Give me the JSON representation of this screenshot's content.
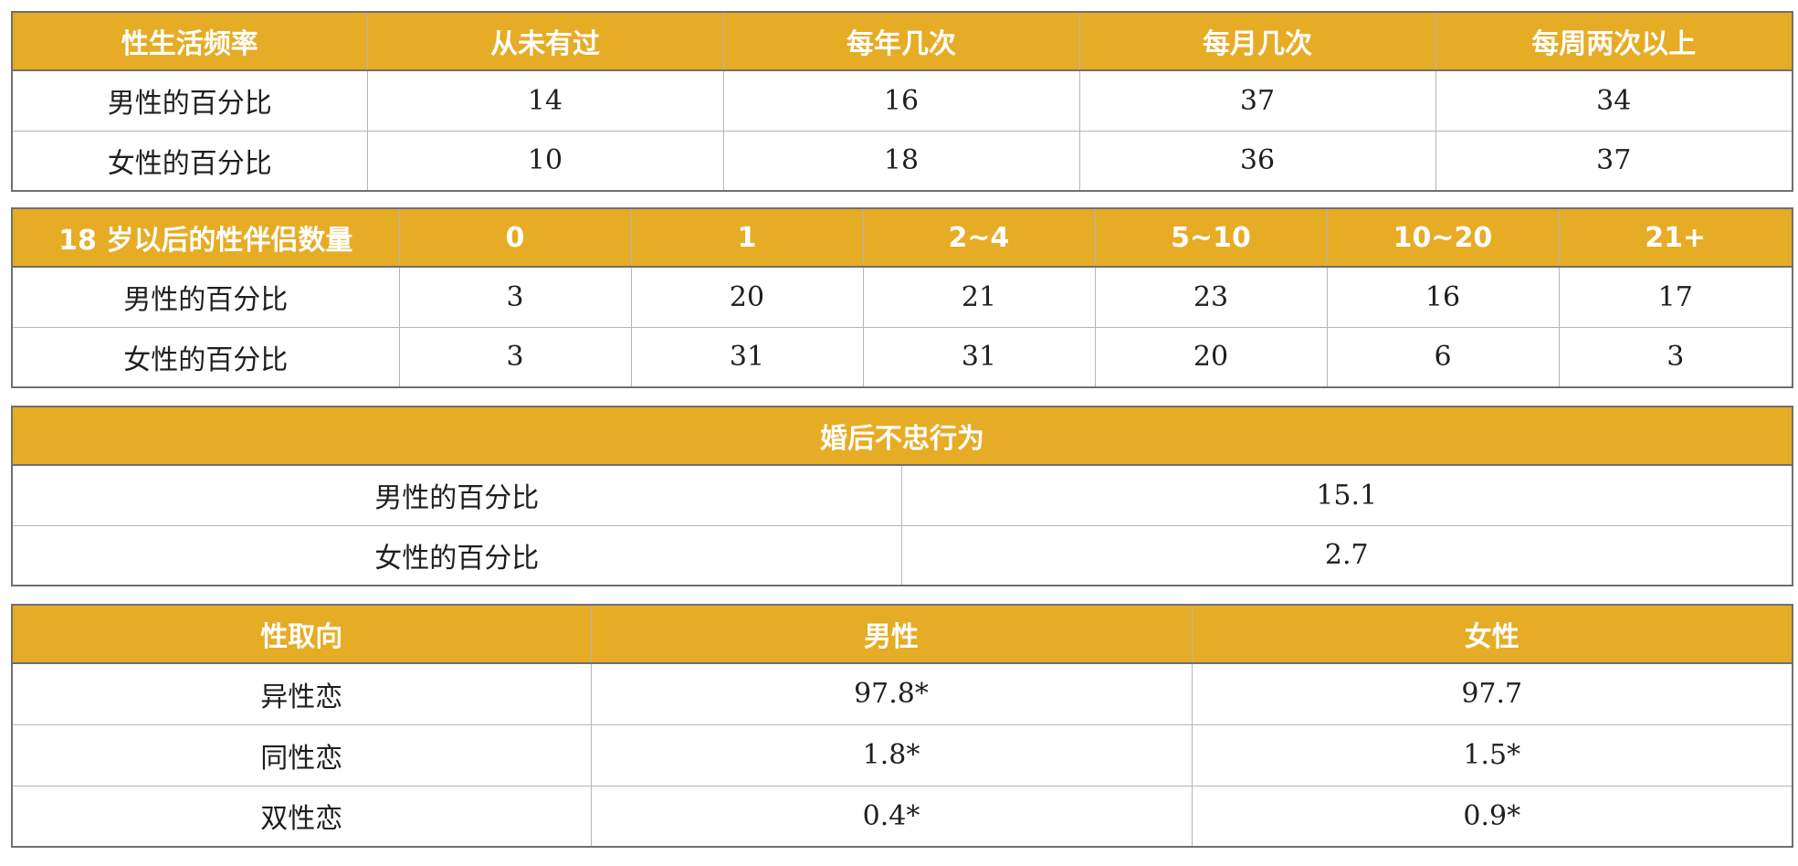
{
  "frequency_table": {
    "headers": [
      "性生活频率",
      "从未有过",
      "每年几次",
      "每月几次",
      "每周两次以上"
    ],
    "rows": [
      {
        "label": "男性的百分比",
        "values": [
          "14",
          "16",
          "37",
          "34"
        ]
      },
      {
        "label": "女性的百分比",
        "values": [
          "10",
          "18",
          "36",
          "37"
        ]
      }
    ]
  },
  "partners_table": {
    "headers": [
      "18 岁以后的性伴侣数量",
      "0",
      "1",
      "2~4",
      "5~10",
      "10~20",
      "21+"
    ],
    "rows": [
      {
        "label": "男性的百分比",
        "values": [
          "3",
          "20",
          "21",
          "23",
          "16",
          "17"
        ]
      },
      {
        "label": "女性的百分比",
        "values": [
          "3",
          "31",
          "31",
          "20",
          "6",
          "3"
        ]
      }
    ]
  },
  "infidelity_table": {
    "header": "婚后不忠行为",
    "rows": [
      {
        "label": "男性的百分比",
        "value": "15.1"
      },
      {
        "label": "女性的百分比",
        "value": "2.7"
      }
    ]
  },
  "orientation_table": {
    "headers": [
      "性取向",
      "男性",
      "女性"
    ],
    "rows": [
      {
        "label": "异性恋",
        "values": [
          "97.8*",
          "97.7"
        ]
      },
      {
        "label": "同性恋",
        "values": [
          "1.8*",
          "1.5*"
        ]
      },
      {
        "label": "双性恋",
        "values": [
          "0.4*",
          "0.9*"
        ]
      }
    ]
  },
  "colors": {
    "header_background": "#e6ac25",
    "header_text": "#ffffff",
    "border": "#6f6f6f"
  }
}
